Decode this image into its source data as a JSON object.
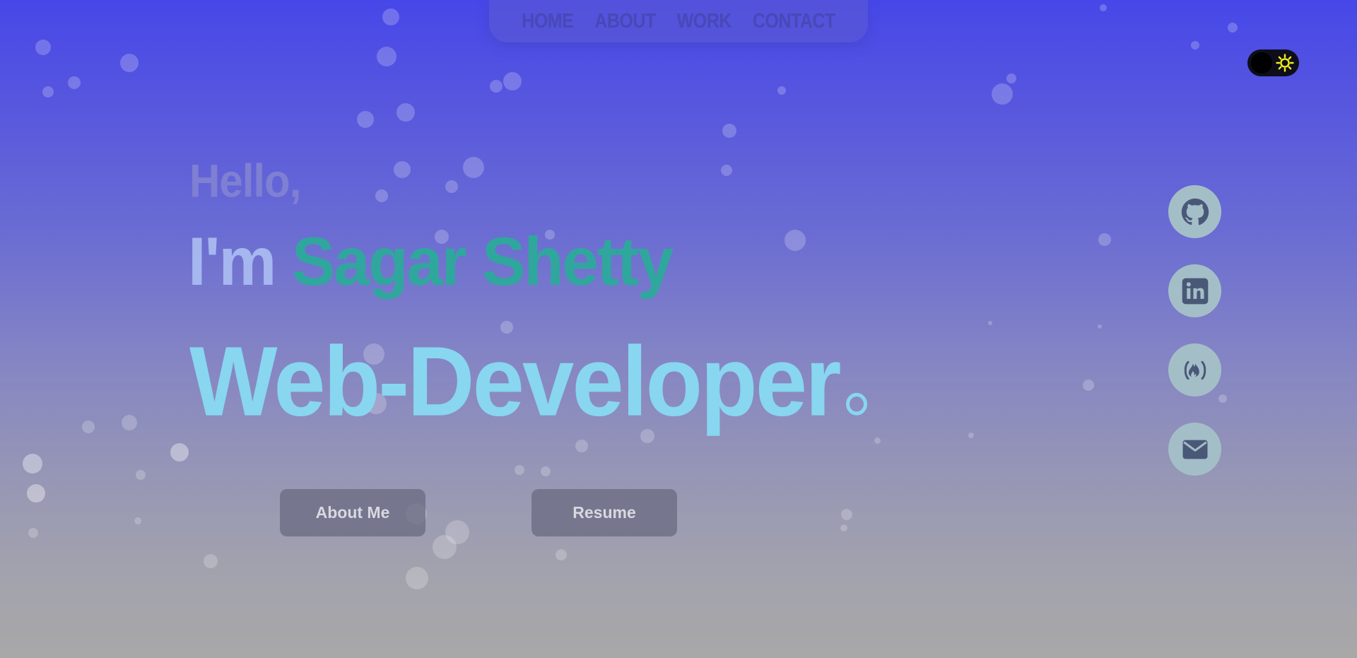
{
  "nav": {
    "items": [
      {
        "label": "HOME"
      },
      {
        "label": "ABOUT"
      },
      {
        "label": "WORK"
      },
      {
        "label": "CONTACT"
      }
    ]
  },
  "theme_toggle": {
    "icon": "sun-icon"
  },
  "hero": {
    "greeting": "Hello,",
    "intro_prefix": "I'm ",
    "name": "Sagar Shetty",
    "role": "Web-Developer"
  },
  "buttons": {
    "about": "About Me",
    "resume": "Resume"
  },
  "social": [
    {
      "icon": "github-icon"
    },
    {
      "icon": "linkedin-icon"
    },
    {
      "icon": "freecodecamp-icon"
    },
    {
      "icon": "email-icon"
    }
  ],
  "colors": {
    "accent_name": "#2fa79d",
    "role_text": "#88d6ef",
    "nav_text": "#4848b8",
    "social_bg": "#a4bec8",
    "social_icon": "#4a5878"
  }
}
